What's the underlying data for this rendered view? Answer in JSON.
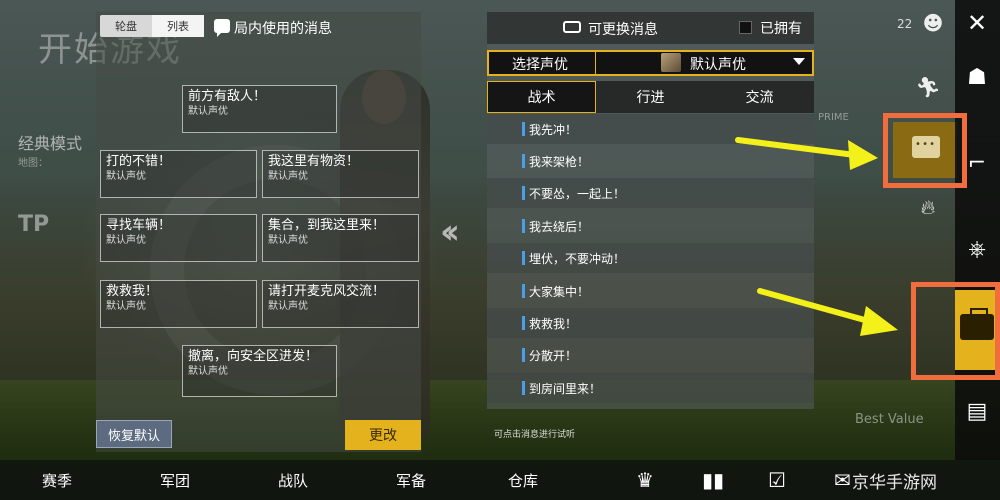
{
  "background": {
    "title": "开始游戏",
    "mode": "经典模式",
    "map": "地图：",
    "tpp": "TP",
    "prime": "PRIME",
    "best_value": "Best Value"
  },
  "left_panel": {
    "tabs": [
      {
        "label": "轮盘",
        "active": false
      },
      {
        "label": "列表",
        "active": true
      }
    ],
    "title": "局内使用的消息",
    "wheel_messages": [
      {
        "text": "前方有敌人！",
        "voice": "默认声优"
      },
      {
        "text": "打的不错！",
        "voice": "默认声优"
      },
      {
        "text": "我这里有物资！",
        "voice": "默认声优"
      },
      {
        "text": "寻找车辆！",
        "voice": "默认声优"
      },
      {
        "text": "集合，到我这里来！",
        "voice": "默认声优"
      },
      {
        "text": "救救我！",
        "voice": "默认声优"
      },
      {
        "text": "请打开麦克风交流！",
        "voice": "默认声优"
      },
      {
        "text": "撤离，向安全区进发！",
        "voice": "默认声优"
      }
    ],
    "reset_label": "恢复默认",
    "change_label": "更改"
  },
  "right_panel": {
    "title": "可更换消息",
    "owned_label": "已拥有",
    "voice_select_label": "选择声优",
    "voice_value": "默认声优",
    "categories": [
      {
        "label": "战术",
        "active": true
      },
      {
        "label": "行进",
        "active": false
      },
      {
        "label": "交流",
        "active": false
      }
    ],
    "messages": [
      "我先冲！",
      "我来架枪！",
      "不要怂，一起上！",
      "我去绕后！",
      "埋伏，不要冲动！",
      "大家集中！",
      "救救我！",
      "分散开！",
      "到房间里来！"
    ],
    "hint": "可点击消息进行试听"
  },
  "sidebar": {
    "coin_count": "22"
  },
  "bottom_nav": {
    "items": [
      "赛季",
      "军团",
      "战队",
      "军备",
      "仓库"
    ],
    "watermark": "京华手游网"
  },
  "colors": {
    "accent": "#e3b21c",
    "highlight": "#f26d3d",
    "arrow": "#f4f01a",
    "message_bar": "#4aa0e8"
  },
  "icons": [
    "chat-bubble-icon",
    "swap-icon",
    "close-icon",
    "emoji-icon",
    "runner-icon",
    "fire-icon",
    "steering-wheel-icon",
    "toolbox-icon",
    "boxes-icon",
    "trophy-icon",
    "stats-icon",
    "checklist-icon",
    "mail-icon",
    "settings-icon"
  ]
}
